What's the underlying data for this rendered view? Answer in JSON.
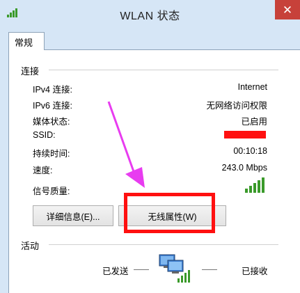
{
  "window": {
    "title": "WLAN 状态",
    "close_symbol": "✕"
  },
  "tabs": [
    {
      "label": "常规"
    }
  ],
  "connection": {
    "group_label": "连接",
    "rows": [
      {
        "label": "IPv4 连接:",
        "value": "Internet"
      },
      {
        "label": "IPv6 连接:",
        "value": "无网络访问权限"
      },
      {
        "label": "媒体状态:",
        "value": "已启用"
      },
      {
        "label": "SSID:",
        "value": ""
      },
      {
        "label": "持续时间:",
        "value": "00:10:18"
      },
      {
        "label": "速度:",
        "value": "243.0 Mbps"
      }
    ],
    "signal_label": "信号质量:",
    "signal_icon": "signal-strength-bars"
  },
  "buttons": {
    "details": "详细信息(E)...",
    "wireless_properties": "无线属性(W)"
  },
  "activity": {
    "group_label": "活动",
    "sent_label": "已发送",
    "received_label": "已接收",
    "icon": "network-computer-icon"
  },
  "colors": {
    "annotation_box": "#ff1010",
    "annotation_arrow": "#e83cf0",
    "close_button": "#c7413a",
    "window_frame": "#d6e6f6"
  }
}
